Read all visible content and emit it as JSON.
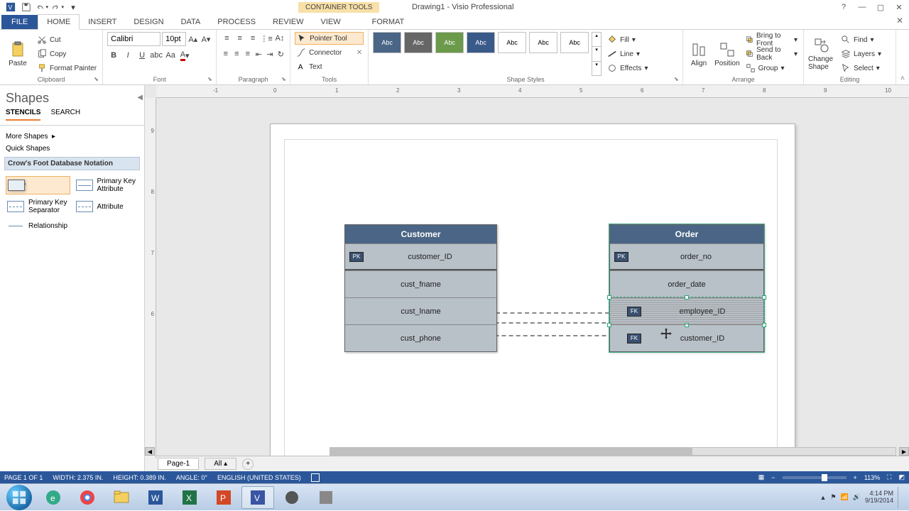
{
  "title": {
    "container_tools": "CONTAINER TOOLS",
    "document": "Drawing1 - Visio Professional"
  },
  "tabs": {
    "file": "FILE",
    "items": [
      "HOME",
      "INSERT",
      "DESIGN",
      "DATA",
      "PROCESS",
      "REVIEW",
      "VIEW",
      "FORMAT"
    ],
    "active": "HOME"
  },
  "ribbon": {
    "clipboard": {
      "paste": "Paste",
      "cut": "Cut",
      "copy": "Copy",
      "format_painter": "Format Painter",
      "label": "Clipboard"
    },
    "font": {
      "name": "Calibri",
      "size": "10pt",
      "label": "Font"
    },
    "paragraph": {
      "label": "Paragraph"
    },
    "tools": {
      "pointer": "Pointer Tool",
      "connector": "Connector",
      "text": "Text",
      "label": "Tools"
    },
    "styles": {
      "label": "Shape Styles",
      "fill": "Fill",
      "line": "Line",
      "effects": "Effects",
      "swatch": "Abc"
    },
    "arrange": {
      "align": "Align",
      "position": "Position",
      "bring_front": "Bring to Front",
      "send_back": "Send to Back",
      "group": "Group",
      "label": "Arrange"
    },
    "editing": {
      "change_shape": "Change Shape",
      "find": "Find",
      "layers": "Layers",
      "select": "Select",
      "label": "Editing"
    }
  },
  "shapes_pane": {
    "title": "Shapes",
    "tab_stencils": "STENCILS",
    "tab_search": "SEARCH",
    "more_shapes": "More Shapes",
    "quick_shapes": "Quick Shapes",
    "stencil": "Crow's Foot Database Notation",
    "items": {
      "entity": "Entity",
      "pk_attr": "Primary Key Attribute",
      "pk_sep": "Primary Key Separator",
      "attribute": "Attribute",
      "relationship": "Relationship"
    }
  },
  "canvas": {
    "hruler_marks": [
      "-1",
      "0",
      "1",
      "2",
      "3",
      "4",
      "5",
      "6",
      "7",
      "8",
      "9",
      "10"
    ],
    "vruler_marks": [
      "9",
      "8",
      "7",
      "6"
    ],
    "customer": {
      "title": "Customer",
      "pk_badge": "PK",
      "pk": "customer_ID",
      "rows": [
        "cust_fname",
        "cust_lname",
        "cust_phone"
      ]
    },
    "order": {
      "title": "Order",
      "pk_badge": "PK",
      "fk_badge": "FK",
      "pk": "order_no",
      "rows": [
        "order_date",
        "employee_ID",
        "customer_ID"
      ]
    }
  },
  "sheets": {
    "page1": "Page-1",
    "all": "All"
  },
  "status": {
    "page": "PAGE 1 OF 1",
    "width": "WIDTH: 2.375 IN.",
    "height": "HEIGHT: 0.389 IN.",
    "angle": "ANGLE: 0°",
    "lang": "ENGLISH (UNITED STATES)",
    "zoom": "113%"
  },
  "tray": {
    "time": "4:14 PM",
    "date": "9/19/2014"
  }
}
